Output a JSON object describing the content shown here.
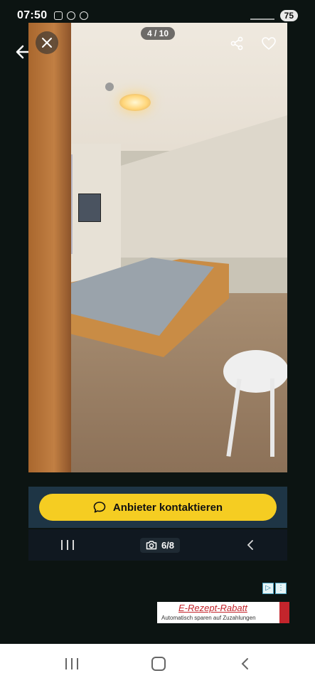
{
  "status_bar": {
    "time": "07:50",
    "battery": "75"
  },
  "viewer": {
    "counter": "4 / 10",
    "close_icon": "close-icon",
    "share_icon": "share-icon",
    "heart_icon": "heart-icon"
  },
  "listing": {
    "contact_button": "Anbieter kontaktieren",
    "photo_count": "6/8"
  },
  "ad": {
    "title": "E-Rezept-Rabatt",
    "subtitle": "Automatisch sparen auf Zuzahlungen"
  },
  "colors": {
    "accent": "#f5cd22",
    "bar": "#1e3545"
  }
}
